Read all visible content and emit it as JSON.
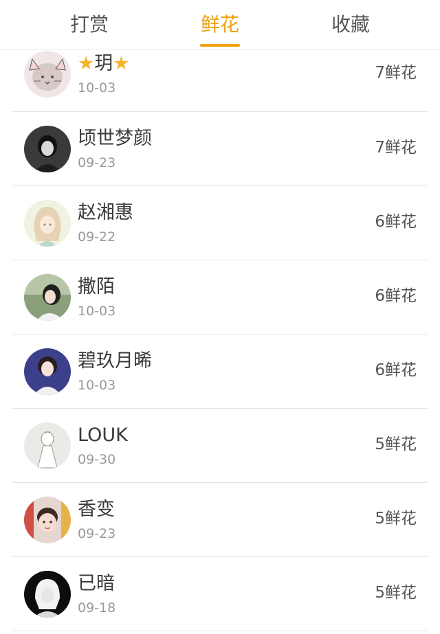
{
  "colors": {
    "accent": "#f0a10c",
    "text_primary": "#3a3a3a",
    "text_secondary": "#999999",
    "divider": "#e4e4e4",
    "star": "#f6b52a"
  },
  "tabs": [
    {
      "label": "打赏",
      "active": false
    },
    {
      "label": "鲜花",
      "active": true
    },
    {
      "label": "收藏",
      "active": false
    }
  ],
  "list": [
    {
      "name_prefix_icon": "star-icon",
      "name": "玥",
      "name_suffix_icon": "star-icon",
      "date": "10-03",
      "flowers": "7鲜花",
      "avatar_icon": "cat-ear-avatar"
    },
    {
      "name": "顷世梦颜",
      "date": "09-23",
      "flowers": "7鲜花",
      "avatar_icon": "girl-dark-avatar"
    },
    {
      "name": "赵湘惠",
      "date": "09-22",
      "flowers": "6鲜花",
      "avatar_icon": "anime-girl-avatar"
    },
    {
      "name": "撒陌",
      "date": "10-03",
      "flowers": "6鲜花",
      "avatar_icon": "girl-outdoor-avatar"
    },
    {
      "name": "碧玖月晞",
      "date": "10-03",
      "flowers": "6鲜花",
      "avatar_icon": "girl-portrait-avatar"
    },
    {
      "name": "LOUK",
      "date": "09-30",
      "flowers": "5鲜花",
      "avatar_icon": "sketch-girl-avatar"
    },
    {
      "name": "香变",
      "date": "09-23",
      "flowers": "5鲜花",
      "avatar_icon": "child-avatar"
    },
    {
      "name": "已暗",
      "date": "09-18",
      "flowers": "5鲜花",
      "avatar_icon": "white-hair-avatar"
    }
  ]
}
